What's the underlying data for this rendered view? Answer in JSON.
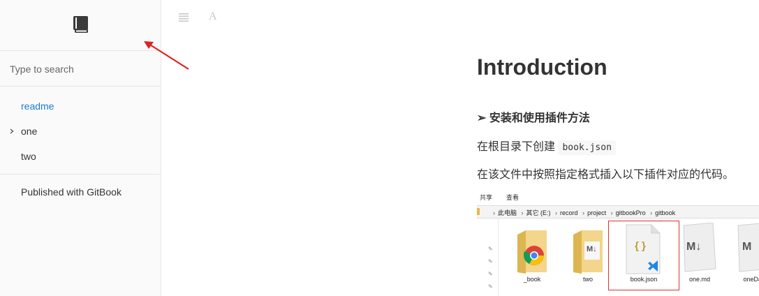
{
  "sidebar": {
    "search_placeholder": "Type to search",
    "items": [
      {
        "label": "readme",
        "active": true
      },
      {
        "label": "one",
        "expandable": true
      },
      {
        "label": "two"
      }
    ],
    "published": "Published with GitBook"
  },
  "toolbar": {
    "menu_icon": "menu-icon",
    "font_icon": "font-icon",
    "font_glyph": "A"
  },
  "content": {
    "title": "Introduction",
    "section_marker": "➢",
    "section_heading": "安装和使用插件方法",
    "p1_text": "在根目录下创建",
    "p1_code": "book.json",
    "p2_text": "在该文件中按照指定格式插入以下插件对应的代码。"
  },
  "explorer": {
    "tabs": [
      "共享",
      "查看"
    ],
    "breadcrumb": [
      "此电脑",
      "其它 (E:)",
      "record",
      "project",
      "gitbookPro",
      "gitbook"
    ],
    "files": [
      {
        "name": "_book",
        "icon": "chrome-folder-icon"
      },
      {
        "name": "two",
        "icon": "markdown-folder-icon"
      },
      {
        "name": "book.json",
        "icon": "json-file-icon",
        "selected": true
      },
      {
        "name": "one.md",
        "icon": "markdown-file-icon"
      },
      {
        "name": "oneDay",
        "icon": "markdown-file-icon"
      }
    ],
    "markdown_glyph": "M↓",
    "markdown_glyph_short": "M",
    "json_glyph": "{ }"
  },
  "colors": {
    "link_active": "#1a7bd1",
    "annotation_arrow": "#e02020",
    "selection_border": "#e03030"
  }
}
